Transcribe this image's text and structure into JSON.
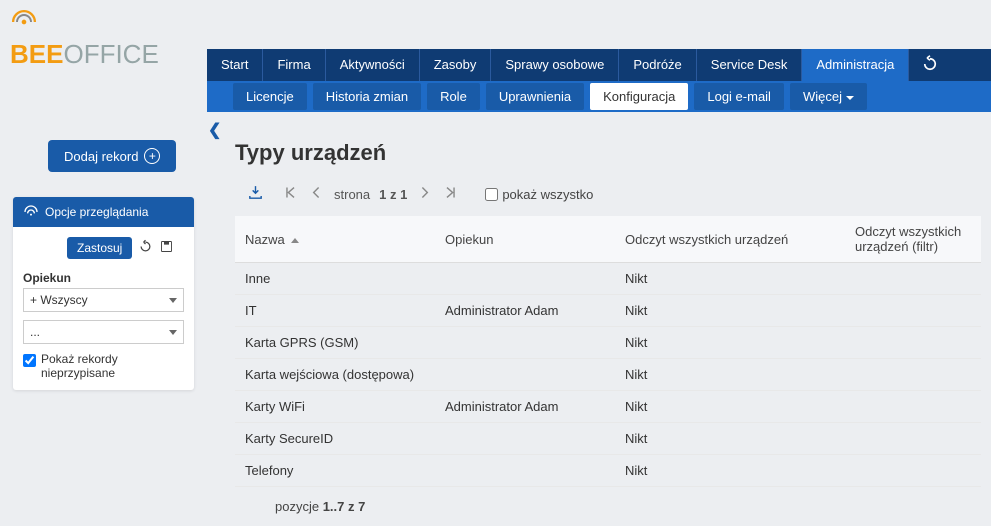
{
  "logo": {
    "brand1": "BEE",
    "brand2": "OFFICE"
  },
  "main_nav": {
    "items": [
      {
        "label": "Start"
      },
      {
        "label": "Firma"
      },
      {
        "label": "Aktywności"
      },
      {
        "label": "Zasoby"
      },
      {
        "label": "Sprawy osobowe"
      },
      {
        "label": "Podróże"
      },
      {
        "label": "Service Desk"
      },
      {
        "label": "Administracja",
        "active": true
      }
    ]
  },
  "sub_nav": {
    "items": [
      {
        "label": "Licencje"
      },
      {
        "label": "Historia zmian"
      },
      {
        "label": "Role"
      },
      {
        "label": "Uprawnienia"
      },
      {
        "label": "Konfiguracja",
        "active": true
      },
      {
        "label": "Logi e-mail"
      },
      {
        "label": "Więcej",
        "more": true
      }
    ]
  },
  "add_button_label": "Dodaj rekord",
  "left_panel": {
    "header": "Opcje przeglądania",
    "apply_label": "Zastosuj",
    "opiekun_label": "Opiekun",
    "opiekun_value": "+ Wszyscy",
    "second_select_value": "...",
    "checkbox_label": "Pokaż rekordy nieprzypisane",
    "checkbox_checked": true
  },
  "page_title": "Typy urządzeń",
  "pager": {
    "prefix": "strona",
    "current": "1 z 1"
  },
  "show_all_label": "pokaż wszystko",
  "table": {
    "headers": [
      "Nazwa",
      "Opiekun",
      "Odczyt wszystkich urządzeń",
      "Odczyt wszystkich urządzeń (filtr)"
    ],
    "rows": [
      {
        "nazwa": "Inne",
        "opiekun": "",
        "odczyt": "Nikt"
      },
      {
        "nazwa": "IT",
        "opiekun": "Administrator Adam",
        "odczyt": "Nikt"
      },
      {
        "nazwa": "Karta GPRS (GSM)",
        "opiekun": "",
        "odczyt": "Nikt"
      },
      {
        "nazwa": "Karta wejściowa (dostępowa)",
        "opiekun": "",
        "odczyt": "Nikt"
      },
      {
        "nazwa": "Karty WiFi",
        "opiekun": "Administrator Adam",
        "odczyt": "Nikt"
      },
      {
        "nazwa": "Karty SecureID",
        "opiekun": "",
        "odczyt": "Nikt"
      },
      {
        "nazwa": "Telefony",
        "opiekun": "",
        "odczyt": "Nikt"
      }
    ]
  },
  "footer": {
    "prefix": "pozycje",
    "range": "1..7 z 7"
  }
}
